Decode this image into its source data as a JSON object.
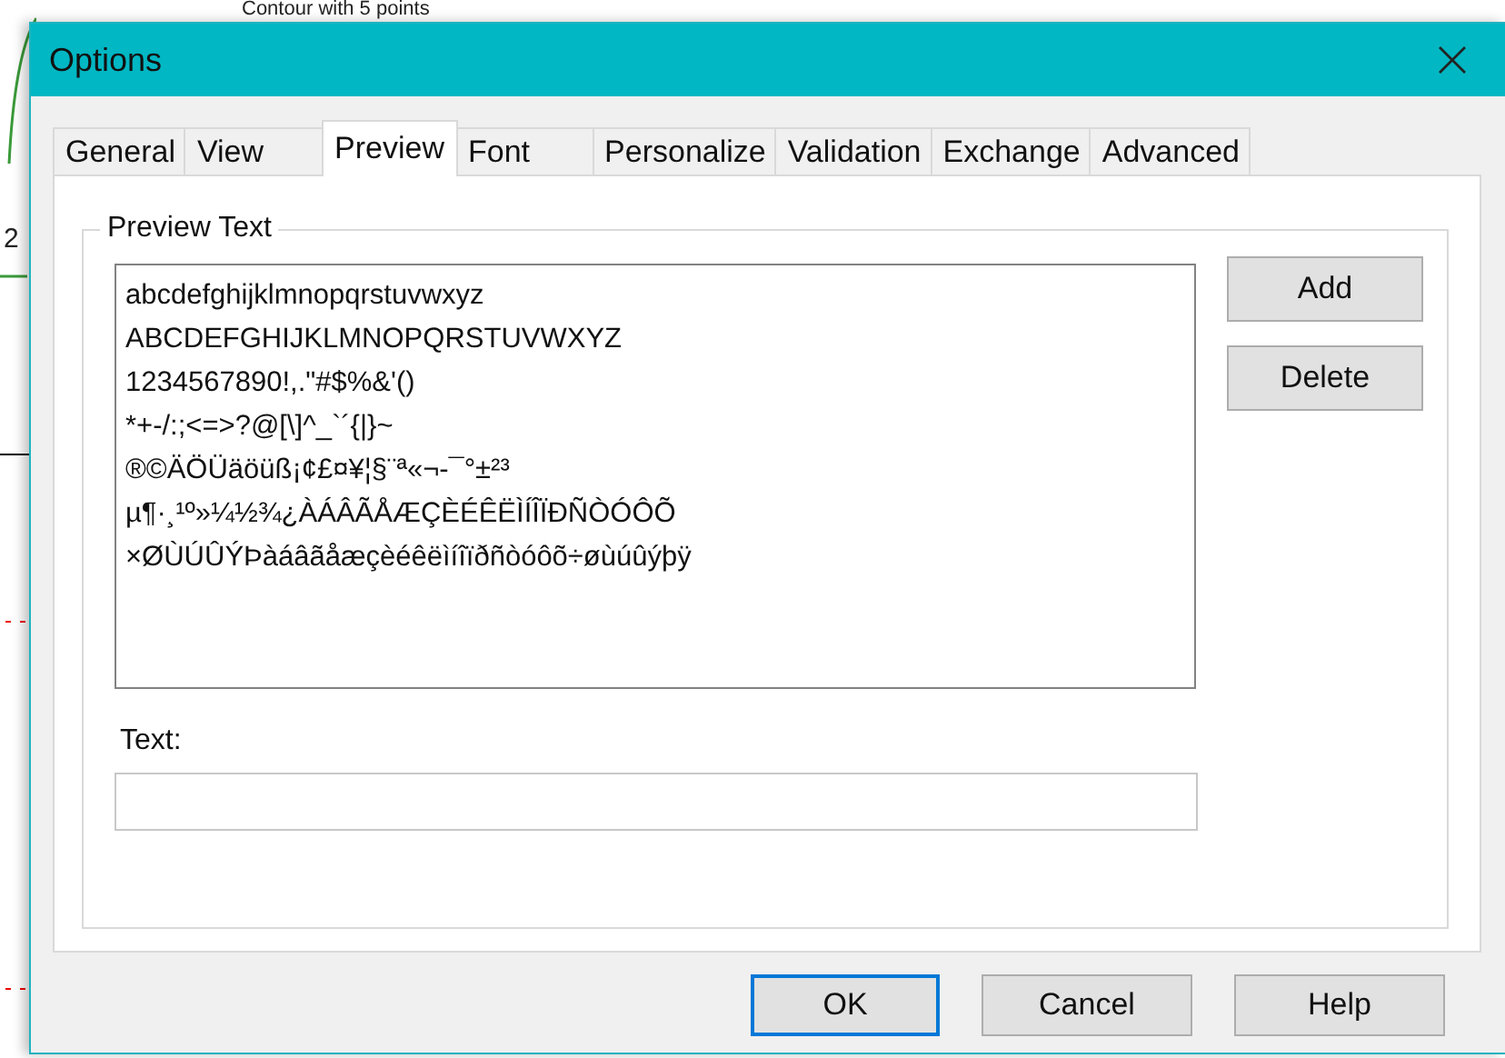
{
  "background": {
    "caption": "Contour with 5 points",
    "axis_label": "2"
  },
  "window": {
    "title": "Options"
  },
  "tabs": [
    {
      "label": "General",
      "selected": false
    },
    {
      "label": "View",
      "selected": false
    },
    {
      "label": "Preview",
      "selected": true
    },
    {
      "label": "Font",
      "selected": false
    },
    {
      "label": "Personalize",
      "selected": false
    },
    {
      "label": "Validation",
      "selected": false
    },
    {
      "label": "Exchange",
      "selected": false
    },
    {
      "label": "Advanced",
      "selected": false
    }
  ],
  "preview_group": {
    "title": "Preview Text",
    "lines": [
      "abcdefghijklmnopqrstuvwxyz",
      "ABCDEFGHIJKLMNOPQRSTUVWXYZ",
      "1234567890!,.\"#$%&'()",
      "*+-/:;<=>?@[\\]^_`´{|}~",
      "®©ÄÖÜäöüß¡¢£¤¥¦§¨ª«¬-¯°±²³",
      "µ¶·¸¹º»¼½¾¿ÀÁÂÃÅÆÇÈÉÊËÌÍÎÏÐÑÒÓÔÕ",
      "×ØÙÚÛÝÞàáâãåæçèéêëìíîïðñòóôõ÷øùúûýþÿ"
    ],
    "side_buttons": [
      "Add",
      "Delete"
    ],
    "text_label": "Text:"
  },
  "buttons": [
    {
      "label": "OK",
      "default": true
    },
    {
      "label": "Cancel",
      "default": false
    },
    {
      "label": "Help",
      "default": false
    }
  ]
}
